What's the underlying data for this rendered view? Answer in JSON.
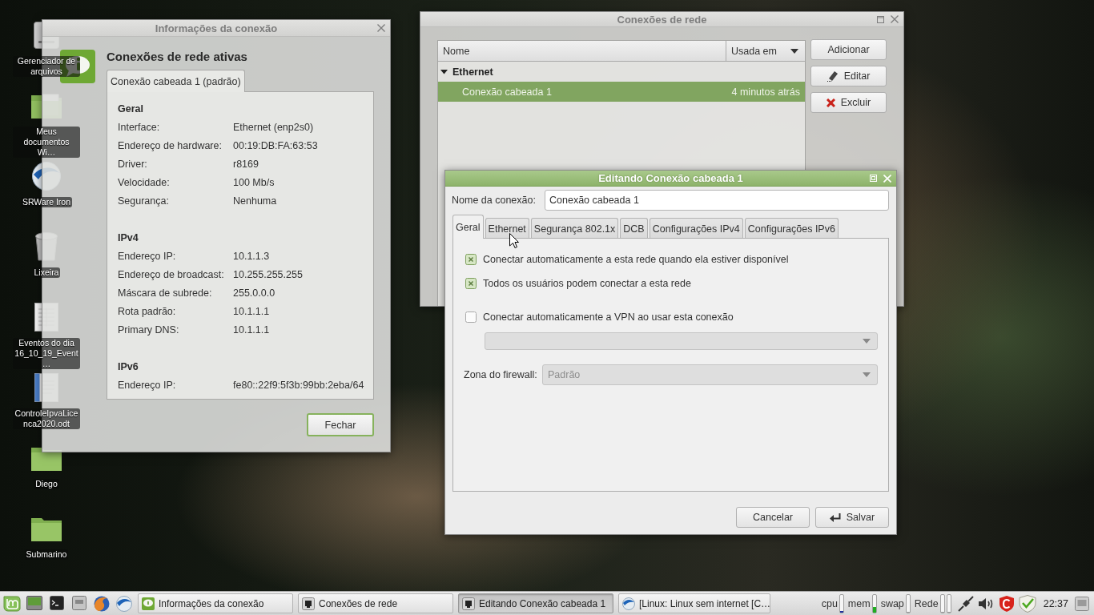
{
  "desktop": {
    "icons": [
      {
        "label": "Gerenciador de arquivos",
        "kind": "drive"
      },
      {
        "label": "Meus documentos Wi…",
        "kind": "documents"
      },
      {
        "label": "SRWare Iron",
        "kind": "sphere"
      },
      {
        "label": "Lixeira",
        "kind": "trash"
      },
      {
        "label": "Eventos do dia 16_10_19_Event…",
        "kind": "sheet"
      },
      {
        "label": "ControleIpvaLicenca2020.odt",
        "kind": "text-document"
      },
      {
        "label": "Diego",
        "kind": "folder"
      },
      {
        "label": "Submarino",
        "kind": "folder"
      }
    ]
  },
  "info_dialog": {
    "title": "Informações da conexão",
    "active": false,
    "heading": "Conexões de rede ativas",
    "tabs": [
      {
        "label": "Conexão cabeada 1 (padrão)",
        "selected": true
      }
    ],
    "sections": [
      {
        "title": "Geral",
        "rows": [
          {
            "label": "Interface:",
            "value": "Ethernet (enp2s0)"
          },
          {
            "label": "Endereço de hardware:",
            "value": "00:19:DB:FA:63:53"
          },
          {
            "label": "Driver:",
            "value": "r8169"
          },
          {
            "label": "Velocidade:",
            "value": "100 Mb/s"
          },
          {
            "label": "Segurança:",
            "value": "Nenhuma"
          }
        ]
      },
      {
        "title": "IPv4",
        "rows": [
          {
            "label": "Endereço IP:",
            "value": "10.1.1.3"
          },
          {
            "label": "Endereço de broadcast:",
            "value": "10.255.255.255"
          },
          {
            "label": "Máscara de subrede:",
            "value": "255.0.0.0"
          },
          {
            "label": "Rota padrão:",
            "value": "10.1.1.1"
          },
          {
            "label": "Primary DNS:",
            "value": "10.1.1.1"
          }
        ]
      },
      {
        "title": "IPv6",
        "rows": [
          {
            "label": "Endereço IP:",
            "value": "fe80::22f9:5f3b:99bb:2eba/64"
          }
        ]
      }
    ],
    "close_button": {
      "label": "Fechar",
      "focused": true
    }
  },
  "connections_window": {
    "title": "Conexões de rede",
    "active": false,
    "columns": [
      {
        "label": "Nome",
        "sorted": false
      },
      {
        "label": "Usada em",
        "sorted": true
      }
    ],
    "groups": [
      {
        "label": "Ethernet",
        "expanded": true,
        "rows": [
          {
            "name": "Conexão cabeada 1",
            "used": "4 minutos atrás",
            "selected": true
          }
        ]
      }
    ],
    "buttons": [
      {
        "label": "Adicionar",
        "kind": "plain"
      },
      {
        "label": "Editar",
        "kind": "edit"
      },
      {
        "label": "Excluir",
        "kind": "delete"
      }
    ]
  },
  "edit_dialog": {
    "title": "Editando Conexão cabeada 1",
    "active": true,
    "name_label": "Nome da conexão:",
    "name_value": "Conexão cabeada 1",
    "tabs": [
      {
        "label": "Geral",
        "selected": true
      },
      {
        "label": "Ethernet",
        "selected": false
      },
      {
        "label": "Segurança 802.1x",
        "selected": false
      },
      {
        "label": "DCB",
        "selected": false
      },
      {
        "label": "Configurações IPv4",
        "selected": false
      },
      {
        "label": "Configurações IPv6",
        "selected": false
      }
    ],
    "options": [
      {
        "label": "Conectar automaticamente a esta rede quando ela estiver disponível",
        "checked": true
      },
      {
        "label": "Todos os usuários podem conectar a esta rede",
        "checked": true
      }
    ],
    "vpn": {
      "label": "Conectar automaticamente a VPN ao usar esta conexão",
      "checked": false,
      "select_disabled": true
    },
    "firewall": {
      "label": "Zona do firewall:",
      "value": "Padrão",
      "disabled": true
    },
    "buttons": [
      {
        "label": "Cancelar",
        "kind": "plain"
      },
      {
        "label": "Salvar",
        "kind": "save"
      }
    ]
  },
  "taskbar": {
    "launchers": [
      {
        "kind": "menu"
      },
      {
        "kind": "screen"
      },
      {
        "kind": "terminal"
      },
      {
        "kind": "drive"
      },
      {
        "kind": "globe"
      },
      {
        "kind": "sphere"
      }
    ],
    "tasks": [
      {
        "label": "Informações da conexão",
        "kind": "info",
        "active": false
      },
      {
        "label": "Conexões de rede",
        "kind": "network",
        "active": false
      },
      {
        "label": "Editando Conexão cabeada 1",
        "kind": "network",
        "active": true
      },
      {
        "label": "[Linux: Linux sem internet [C…",
        "kind": "sphere",
        "active": false
      }
    ],
    "monitors": [
      {
        "label": "cpu",
        "bars": [
          {
            "level": 0.06,
            "color": "#1f2f9e"
          }
        ]
      },
      {
        "label": "mem",
        "bars": [
          {
            "level": 0.3,
            "color": "#1fae1f"
          }
        ]
      },
      {
        "label": "swap",
        "bars": [
          {
            "level": 0
          }
        ]
      },
      {
        "label": "Rede",
        "bars": [
          {
            "level": 0
          },
          {
            "level": 0
          }
        ]
      }
    ],
    "tray": [
      {
        "kind": "plug"
      },
      {
        "kind": "volume"
      },
      {
        "kind": "shield"
      },
      {
        "kind": "check-shield"
      }
    ],
    "clock": "22:37"
  }
}
